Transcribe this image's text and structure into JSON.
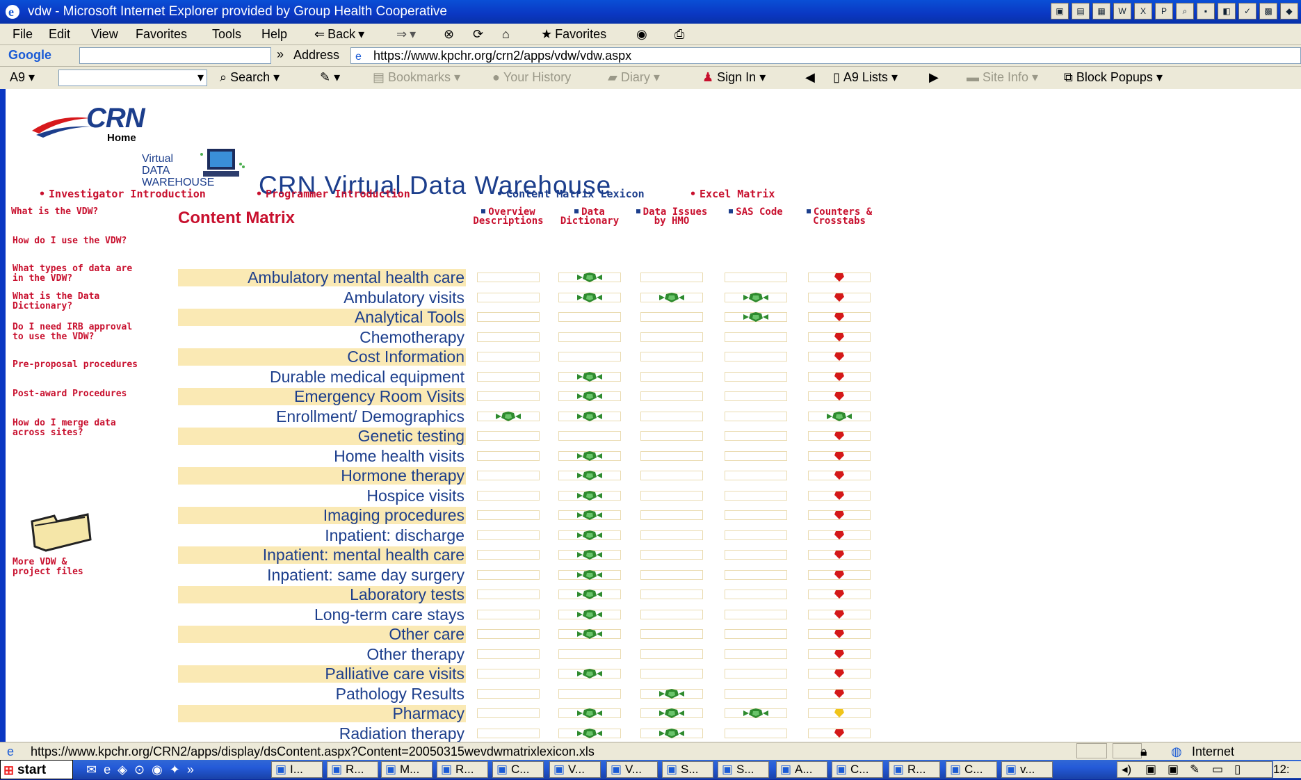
{
  "window": {
    "title": "vdw - Microsoft Internet Explorer provided by Group Health Cooperative"
  },
  "menu": [
    "File",
    "Edit",
    "View",
    "Favorites",
    "Tools",
    "Help"
  ],
  "toolbar": {
    "back": "Back",
    "favorites": "Favorites"
  },
  "google": {
    "label": "Google",
    "address_label": "Address",
    "url": "https://www.kpchr.org/crn2/apps/vdw/vdw.aspx"
  },
  "toolbar3": {
    "search": "Search",
    "bookmarks": "Bookmarks",
    "history": "Your History",
    "diary": "Diary",
    "signin": "Sign In",
    "lists": "A9 Lists",
    "siteinfo": "Site Info",
    "popups": "Block Popups"
  },
  "page": {
    "crn_logo": "CRN",
    "crn_home": "Home",
    "vdw_logo": [
      "Virtual",
      "DATA",
      "WAREHOUSE"
    ],
    "title": "CRN Virtual Data Warehouse",
    "topnav": [
      "Investigator Introduction",
      "Programmer Introduction",
      "Content Matrix Lexicon",
      "Excel Matrix"
    ],
    "sidenav": [
      "What is the VDW?",
      "How do I use the VDW?",
      "What types of data are in the VDW?",
      "What is the Data Dictionary?",
      "Do I need IRB approval to use the VDW?",
      "Pre-proposal procedures",
      "Post-award Procedures",
      "How do I merge data across sites?"
    ],
    "more_files": "More VDW & project files",
    "matrix_title": "Content Matrix",
    "columns": [
      {
        "l1": "Overview",
        "l2": "Descriptions"
      },
      {
        "l1": "Data",
        "l2": "Dictionary"
      },
      {
        "l1": "Data Issues",
        "l2": "by HMO"
      },
      {
        "l1": "SAS Code",
        "l2": ""
      },
      {
        "l1": "Counters &",
        "l2": "Crosstabs"
      }
    ],
    "rows": [
      {
        "label": "Ambulatory mental health care",
        "marks": [
          "",
          "g",
          "",
          "",
          "r"
        ]
      },
      {
        "label": "Ambulatory visits",
        "marks": [
          "",
          "g",
          "g",
          "g",
          "r"
        ]
      },
      {
        "label": "Analytical Tools",
        "marks": [
          "",
          "",
          "",
          "g",
          "r"
        ]
      },
      {
        "label": "Chemotherapy",
        "marks": [
          "",
          "",
          "",
          "",
          "r"
        ]
      },
      {
        "label": "Cost Information",
        "marks": [
          "",
          "",
          "",
          "",
          "r"
        ]
      },
      {
        "label": "Durable medical equipment",
        "marks": [
          "",
          "g",
          "",
          "",
          "r"
        ]
      },
      {
        "label": "Emergency Room Visits",
        "marks": [
          "",
          "g",
          "",
          "",
          "r"
        ]
      },
      {
        "label": "Enrollment/ Demographics",
        "marks": [
          "g",
          "g",
          "",
          "",
          "g"
        ]
      },
      {
        "label": "Genetic testing",
        "marks": [
          "",
          "",
          "",
          "",
          "r"
        ]
      },
      {
        "label": "Home health visits",
        "marks": [
          "",
          "g",
          "",
          "",
          "r"
        ]
      },
      {
        "label": "Hormone therapy",
        "marks": [
          "",
          "g",
          "",
          "",
          "r"
        ]
      },
      {
        "label": "Hospice visits",
        "marks": [
          "",
          "g",
          "",
          "",
          "r"
        ]
      },
      {
        "label": "Imaging procedures",
        "marks": [
          "",
          "g",
          "",
          "",
          "r"
        ]
      },
      {
        "label": "Inpatient: discharge",
        "marks": [
          "",
          "g",
          "",
          "",
          "r"
        ]
      },
      {
        "label": "Inpatient: mental health care",
        "marks": [
          "",
          "g",
          "",
          "",
          "r"
        ]
      },
      {
        "label": "Inpatient: same day surgery",
        "marks": [
          "",
          "g",
          "",
          "",
          "r"
        ]
      },
      {
        "label": "Laboratory tests",
        "marks": [
          "",
          "g",
          "",
          "",
          "r"
        ]
      },
      {
        "label": "Long-term care stays",
        "marks": [
          "",
          "g",
          "",
          "",
          "r"
        ]
      },
      {
        "label": "Other care",
        "marks": [
          "",
          "g",
          "",
          "",
          "r"
        ]
      },
      {
        "label": "Other therapy",
        "marks": [
          "",
          "",
          "",
          "",
          "r"
        ]
      },
      {
        "label": "Palliative care visits",
        "marks": [
          "",
          "g",
          "",
          "",
          "r"
        ]
      },
      {
        "label": "Pathology Results",
        "marks": [
          "",
          "",
          "g",
          "",
          "r"
        ]
      },
      {
        "label": "Pharmacy",
        "marks": [
          "",
          "g",
          "g",
          "g",
          "y"
        ]
      },
      {
        "label": "Radiation therapy",
        "marks": [
          "",
          "g",
          "g",
          "",
          "r"
        ]
      }
    ]
  },
  "status": {
    "url": "https://www.kpchr.org/CRN2/apps/display/dsContent.aspx?Content=20050315wevdwmatrixlexicon.xls",
    "zone": "Internet"
  },
  "taskbar": {
    "start": "start",
    "items": [
      "I...",
      "R...",
      "M...",
      "R...",
      "C...",
      "V...",
      "V...",
      "S...",
      "S...",
      "A...",
      "C...",
      "R...",
      "C...",
      "v..."
    ],
    "clock": "12:"
  },
  "colors": {
    "green_mark": "#2e8b2e",
    "red_mark": "#d41818",
    "yellow_mark": "#f0c419",
    "highlight": "#fae9b4"
  }
}
